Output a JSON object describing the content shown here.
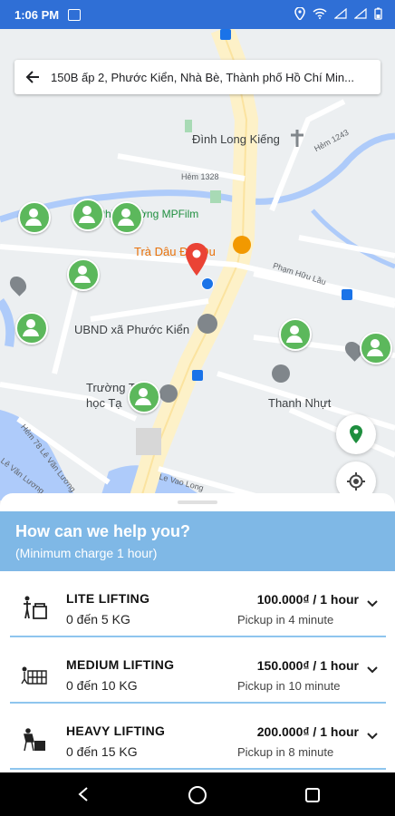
{
  "status_bar": {
    "time": "1:06 PM"
  },
  "search": {
    "address": "150B ấp 2, Phước Kiển, Nhà Bè, Thành phố Hồ Chí Min..."
  },
  "map_labels": {
    "dinh": "Đình Long Kiếng",
    "hem1243": "Hẻm 1243",
    "hem1328": "Hẻm 1328",
    "mpfilm": "Phim trường MPFilm",
    "tradau": "Trà Dâu Đại Du",
    "phamhuulau": "Phạm Hữu Lầu",
    "ubnd": "UBND xã Phước Kiển",
    "truong": "Trường T",
    "hoc": "học Tạ",
    "thanhnhut": "Thanh Nhựt",
    "hem78": "Hẻm 78 Lê Văn Lương",
    "levanluong": "Lê Văn Lương",
    "levanlong2": "Le Vao Long"
  },
  "sheet": {
    "title": "How can we help you?",
    "subtitle": "(Minimum charge 1 hour)",
    "options": [
      {
        "name": "LITE LIFTING",
        "weight": "0 đến 5 KG",
        "price": "100.000₫ / 1 hour",
        "pickup": "Pickup in 4 minute",
        "icon": "lite-lifting-icon"
      },
      {
        "name": "MEDIUM LIFTING",
        "weight": "0 đến 10 KG",
        "price": "150.000₫ / 1 hour",
        "pickup": "Pickup in 10 minute",
        "icon": "medium-lifting-icon"
      },
      {
        "name": "HEAVY LIFTING",
        "weight": "0 đến 15 KG",
        "price": "200.000₫ / 1 hour",
        "pickup": "Pickup in 8 minute",
        "icon": "heavy-lifting-icon"
      }
    ]
  },
  "colors": {
    "status": "#2f6fd6",
    "header": "#7fb8e6",
    "driver": "#5cb85c",
    "pin": "#ea4335"
  }
}
